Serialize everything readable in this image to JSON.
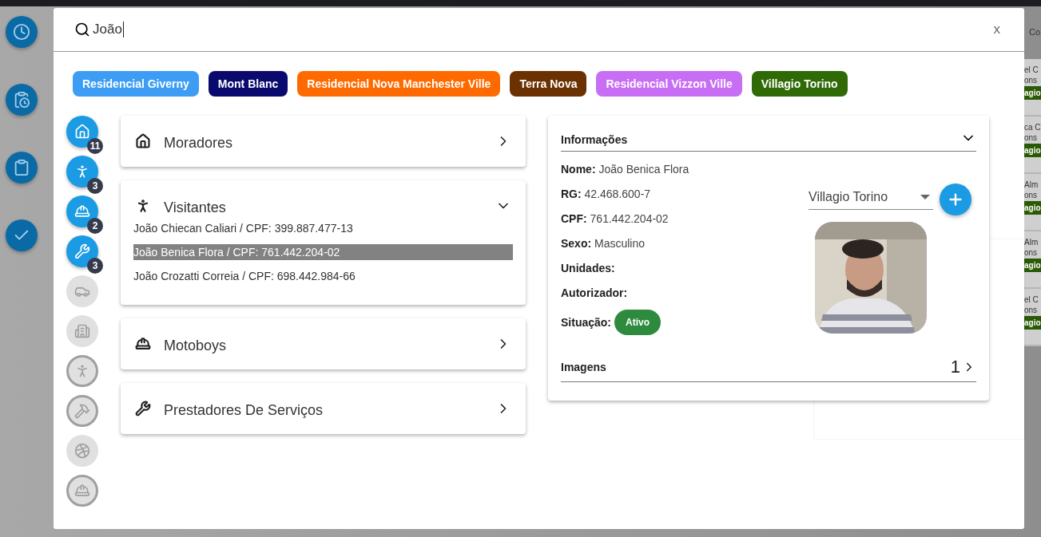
{
  "search": {
    "value": "João",
    "close": "x"
  },
  "chips": [
    {
      "label": "Residencial Giverny",
      "color": "#3d9df5"
    },
    {
      "label": "Mont Blanc",
      "color": "#0a0a6e"
    },
    {
      "label": "Residencial Nova Manchester Ville",
      "color": "#ff6a00"
    },
    {
      "label": "Terra Nova",
      "color": "#6b3100"
    },
    {
      "label": "Residencial Vizzon Ville",
      "color": "#c86ef5"
    },
    {
      "label": "Villagio Torino",
      "color": "#2f6a06"
    }
  ],
  "categories": [
    {
      "count": "11",
      "disabled": false
    },
    {
      "count": "3",
      "disabled": false
    },
    {
      "count": "2",
      "disabled": false
    },
    {
      "count": "3",
      "disabled": false
    },
    {
      "disabled": true
    },
    {
      "disabled": true
    },
    {
      "disabled": true
    },
    {
      "disabled": true
    },
    {
      "disabled": true
    },
    {
      "disabled": true
    }
  ],
  "sections": [
    {
      "title": "Moradores",
      "expanded": false
    },
    {
      "title": "Visitantes",
      "expanded": true,
      "items": [
        {
          "text": "João Chiecan Caliari / CPF: 399.887.477-13",
          "selected": false
        },
        {
          "text": "João Benica Flora / CPF: 761.442.204-02",
          "selected": true
        },
        {
          "text": "João Crozatti Correia / CPF: 698.442.984-66",
          "selected": false
        }
      ]
    },
    {
      "title": "Motoboys",
      "expanded": false
    },
    {
      "title": "Prestadores De Serviços",
      "expanded": false
    }
  ],
  "info": {
    "title": "Informações",
    "expanded": true,
    "fields": [
      {
        "label": "Nome:",
        "value": "João Benica Flora"
      },
      {
        "label": "RG:",
        "value": "42.468.600-7"
      },
      {
        "label": "CPF:",
        "value": "761.442.204-02"
      },
      {
        "label": "Sexo:",
        "value": "Masculino"
      },
      {
        "label": "Unidades:"
      },
      {
        "label": "Autorizador:"
      }
    ],
    "status": {
      "label": "Situação:",
      "badge": "Ativo"
    },
    "unit_select": {
      "value": "Villagio Torino"
    },
    "images": {
      "label": "Imagens",
      "count": "1"
    }
  },
  "background_list": {
    "header": "Co",
    "rows": [
      {
        "line_1": "el C",
        "line_2": "ons",
        "tag": "agio"
      },
      {
        "line_1": "ca C",
        "line_2": "ons",
        "tag": "agio"
      },
      {
        "line_1": "Alm",
        "line_2": "ons",
        "tag": "agio"
      },
      {
        "line_1": "Alm",
        "line_2": "ons",
        "tag": "agio"
      },
      {
        "line_1": "el C",
        "line_2": "ons",
        "tag": "agio"
      }
    ]
  }
}
